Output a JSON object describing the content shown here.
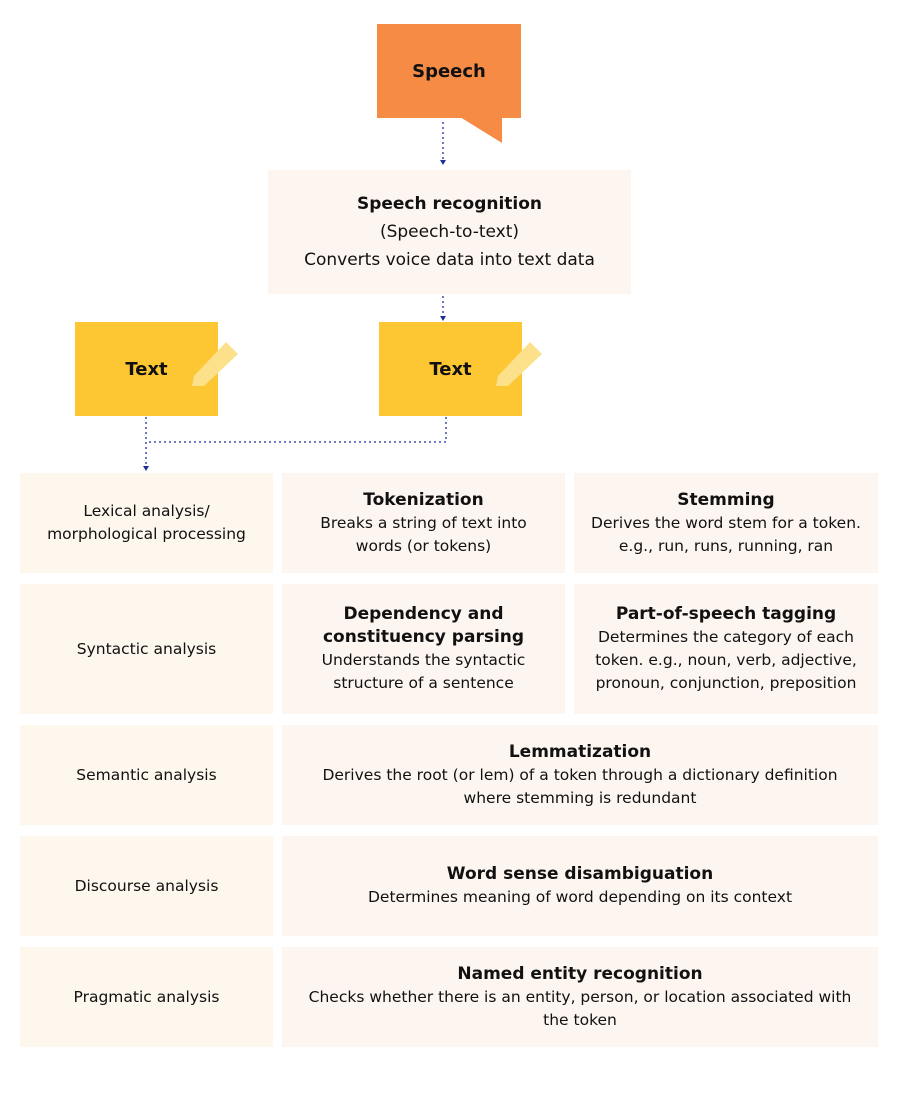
{
  "colors": {
    "speech_bubble": "#f68b45",
    "text_note": "#fdc734",
    "pencil": "#fde08a",
    "process_box": "#fdf5f0",
    "stage_box": "#fdf7ed",
    "connector": "#1f2f9e"
  },
  "speech": {
    "label": "Speech",
    "icon": "speech-bubble-icon"
  },
  "speech_recognition": {
    "title": "Speech recognition",
    "subtitle": "(Speech-to-text)",
    "description": "Converts voice data into text data"
  },
  "text_notes": [
    {
      "label": "Text",
      "icon": "pencil-icon"
    },
    {
      "label": "Text",
      "icon": "pencil-icon"
    }
  ],
  "stages": [
    {
      "name": "Lexical analysis/ morphological processing",
      "line1": "Lexical analysis/",
      "line2": "morphological processing",
      "tasks": [
        {
          "title": "Tokenization",
          "description": "Breaks a string of text into words (or tokens)"
        },
        {
          "title": "Stemming",
          "description": "Derives the word stem for a token. e.g., run, runs, running, ran"
        }
      ]
    },
    {
      "name": "Syntactic analysis",
      "tasks": [
        {
          "title": "Dependency and constituency parsing",
          "description": "Understands the syntactic structure of a sentence"
        },
        {
          "title": "Part-of-speech tagging",
          "description": "Determines the category of each token. e.g., noun, verb, adjective, pronoun, conjunction, preposition"
        }
      ]
    },
    {
      "name": "Semantic analysis",
      "tasks": [
        {
          "title": "Lemmatization",
          "description": "Derives the root (or lem) of a token through a dictionary definition where stemming is redundant"
        }
      ]
    },
    {
      "name": "Discourse analysis",
      "tasks": [
        {
          "title": "Word sense disambiguation",
          "description": "Determines meaning of word depending on its context"
        }
      ]
    },
    {
      "name": "Pragmatic analysis",
      "tasks": [
        {
          "title": "Named entity recognition",
          "description": "Checks whether there is an entity, person, or location associated with the token"
        }
      ]
    }
  ]
}
